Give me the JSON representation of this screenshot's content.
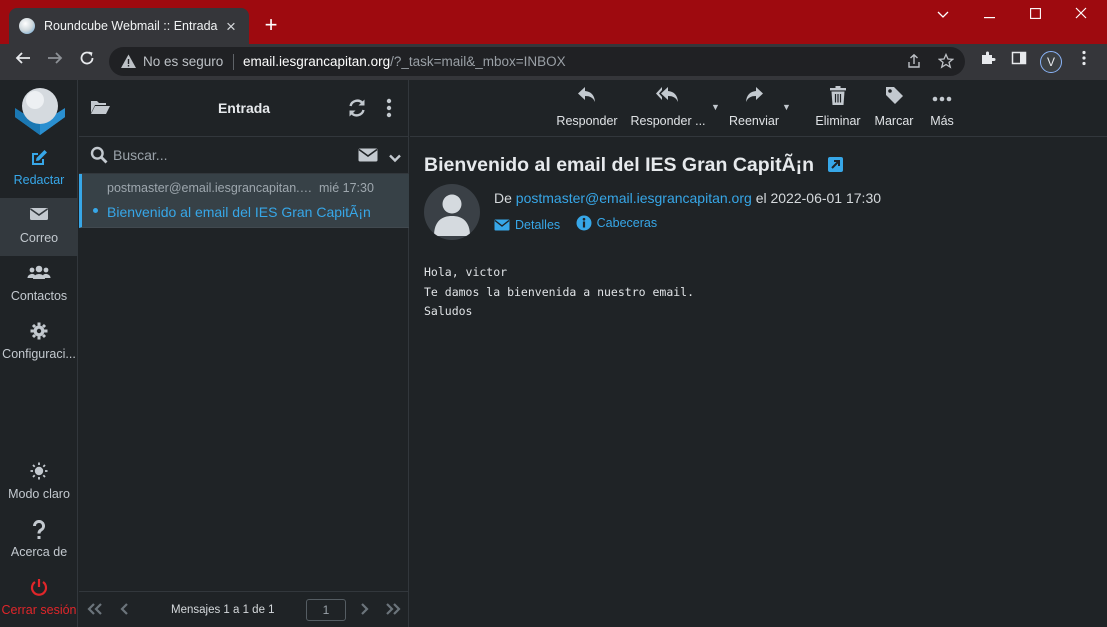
{
  "browser": {
    "tab_title": "Roundcube Webmail :: Entrada",
    "tab_close": "×",
    "new_tab": "+",
    "security_label": "No es seguro",
    "url_host": "email.iesgrancapitan.org",
    "url_path": "/?_task=mail&_mbox=INBOX",
    "profile_initial": "V",
    "accent_color": "#9e0a0f"
  },
  "sidebar": {
    "items": [
      {
        "label": "Redactar",
        "icon": "compose-icon"
      },
      {
        "label": "Correo",
        "icon": "mail-icon"
      },
      {
        "label": "Contactos",
        "icon": "contacts-icon"
      },
      {
        "label": "Configuraci...",
        "icon": "gear-icon"
      },
      {
        "label": "Modo claro",
        "icon": "sun-icon"
      },
      {
        "label": "Acerca de",
        "icon": "question-icon"
      },
      {
        "label": "Cerrar sesión",
        "icon": "power-icon"
      }
    ]
  },
  "mailbox": {
    "title": "Entrada",
    "search_placeholder": "Buscar...",
    "messages": [
      {
        "from": "postmaster@email.iesgrancapitan.org",
        "date": "mié 17:30",
        "subject": "Bienvenido al email del IES Gran CapitÃ¡n"
      }
    ],
    "pagination": {
      "label": "Mensajes 1 a 1 de 1",
      "page": "1"
    }
  },
  "toolbar": {
    "reply": "Responder",
    "reply_all": "Responder ...",
    "forward": "Reenviar",
    "delete": "Eliminar",
    "mark": "Marcar",
    "more": "Más"
  },
  "message": {
    "subject": "Bienvenido al email del IES Gran CapitÃ¡n",
    "from_prefix": "De",
    "from": "postmaster@email.iesgrancapitan.org",
    "date_text": "el 2022-06-01 17:30",
    "details_label": "Detalles",
    "headers_label": "Cabeceras",
    "body_lines": [
      "Hola, victor",
      "Te damos la bienvenida a nuestro email.",
      "Saludos"
    ]
  },
  "colors": {
    "accent": "#37a7e8",
    "logout": "#e0262a",
    "background": "#1f2326"
  }
}
